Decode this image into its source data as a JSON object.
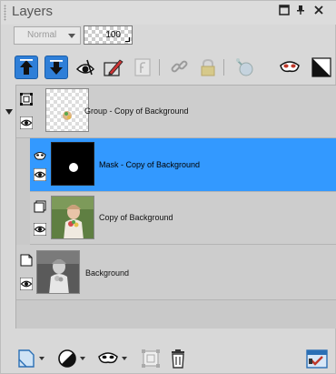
{
  "window": {
    "title": "Layers",
    "buttons": [
      "maximize",
      "pin",
      "close"
    ]
  },
  "blend": {
    "mode": "Normal",
    "opacity": "100"
  },
  "toolbar": {
    "tools": [
      "move-layer-up-icon",
      "move-layer-down-icon",
      "visibility-toggle-icon",
      "edit-layer-icon",
      "lock-transparency-icon",
      "link-layers-icon",
      "lock-layer-icon",
      "layer-effects-icon",
      "mask-icon",
      "adjustment-icon"
    ]
  },
  "layers": [
    {
      "name": "Group - Copy of Background",
      "type": "group"
    },
    {
      "name": "Mask - Copy of Background",
      "type": "mask",
      "selected": true
    },
    {
      "name": "Copy of Background",
      "type": "raster"
    },
    {
      "name": "Background",
      "type": "raster"
    }
  ],
  "bottom_toolbar": {
    "tools": [
      "new-layer-icon",
      "new-adjustment-layer-icon",
      "new-mask-icon",
      "group-icon",
      "delete-icon",
      "layer-properties-icon"
    ]
  },
  "colors": {
    "selection": "#3399ff",
    "panel": "#d8d8d8",
    "row": "#cdcdcd"
  }
}
